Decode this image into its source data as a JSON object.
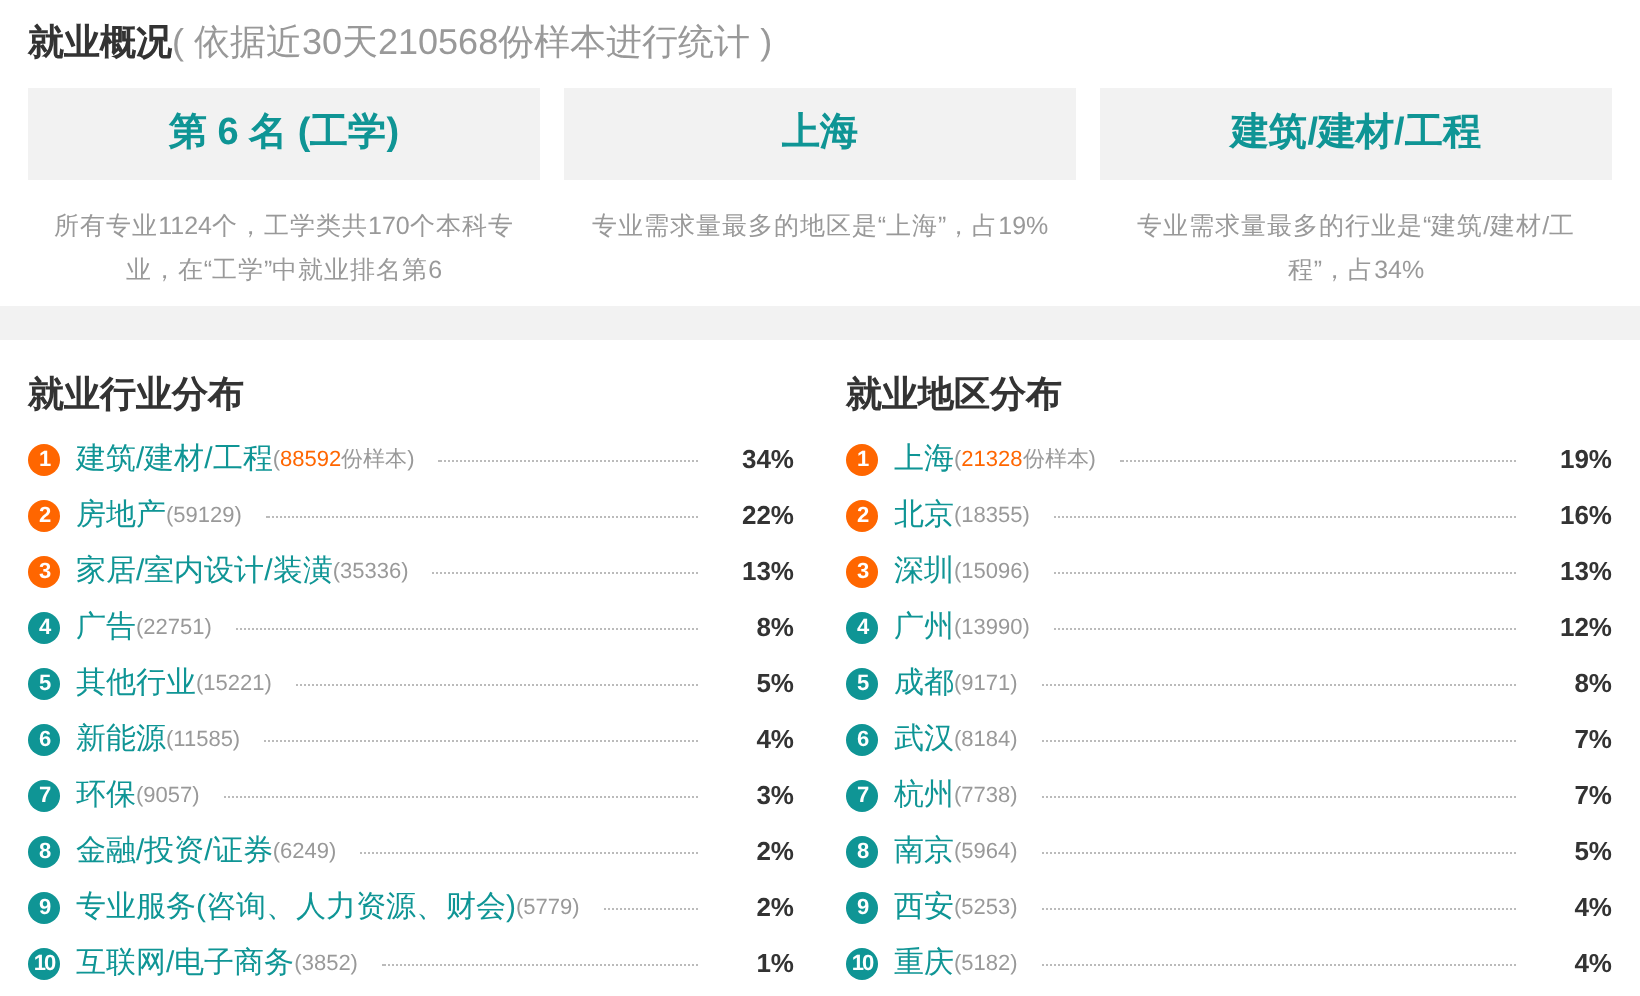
{
  "header": {
    "title": "就业概况",
    "subtitle": "( 依据近30天210568份样本进行统计 )"
  },
  "summary": [
    {
      "value": "第 6 名 (工学)",
      "description": "所有专业1124个，工学类共170个本科专业，在“工学”中就业排名第6"
    },
    {
      "value": "上海",
      "description": "专业需求量最多的地区是“上海”，占19%"
    },
    {
      "value": "建筑/建材/工程",
      "description": "专业需求量最多的行业是“建筑/建材/工程”，占34%"
    }
  ],
  "industry": {
    "title": "就业行业分布",
    "items": [
      {
        "rank": "1",
        "color": "#ff6600",
        "name": "建筑/建材/工程",
        "count_before": "(",
        "count_highlight": "88592",
        "count_after": "份样本)",
        "percent": "34%"
      },
      {
        "rank": "2",
        "color": "#ff6600",
        "name": "房地产",
        "count": "(59129)",
        "percent": "22%"
      },
      {
        "rank": "3",
        "color": "#ff6600",
        "name": "家居/室内设计/装潢",
        "count": "(35336)",
        "percent": "13%"
      },
      {
        "rank": "4",
        "color": "#0f9595",
        "name": "广告",
        "count": "(22751)",
        "percent": "8%"
      },
      {
        "rank": "5",
        "color": "#0f9595",
        "name": "其他行业",
        "count": "(15221)",
        "percent": "5%"
      },
      {
        "rank": "6",
        "color": "#0f9595",
        "name": "新能源",
        "count": "(11585)",
        "percent": "4%"
      },
      {
        "rank": "7",
        "color": "#0f9595",
        "name": "环保",
        "count": "(9057)",
        "percent": "3%"
      },
      {
        "rank": "8",
        "color": "#0f9595",
        "name": "金融/投资/证券",
        "count": "(6249)",
        "percent": "2%"
      },
      {
        "rank": "9",
        "color": "#0f9595",
        "name": "专业服务(咨询、人力资源、财会)",
        "count": "(5779)",
        "percent": "2%"
      },
      {
        "rank": "10",
        "color": "#0f9595",
        "name": "互联网/电子商务",
        "count": "(3852)",
        "percent": "1%"
      }
    ]
  },
  "region": {
    "title": "就业地区分布",
    "items": [
      {
        "rank": "1",
        "color": "#ff6600",
        "name": "上海",
        "count_before": "(",
        "count_highlight": "21328",
        "count_after": "份样本)",
        "percent": "19%"
      },
      {
        "rank": "2",
        "color": "#ff6600",
        "name": "北京",
        "count": "(18355)",
        "percent": "16%"
      },
      {
        "rank": "3",
        "color": "#ff6600",
        "name": "深圳",
        "count": "(15096)",
        "percent": "13%"
      },
      {
        "rank": "4",
        "color": "#0f9595",
        "name": "广州",
        "count": "(13990)",
        "percent": "12%"
      },
      {
        "rank": "5",
        "color": "#0f9595",
        "name": "成都",
        "count": "(9171)",
        "percent": "8%"
      },
      {
        "rank": "6",
        "color": "#0f9595",
        "name": "武汉",
        "count": "(8184)",
        "percent": "7%"
      },
      {
        "rank": "7",
        "color": "#0f9595",
        "name": "杭州",
        "count": "(7738)",
        "percent": "7%"
      },
      {
        "rank": "8",
        "color": "#0f9595",
        "name": "南京",
        "count": "(5964)",
        "percent": "5%"
      },
      {
        "rank": "9",
        "color": "#0f9595",
        "name": "西安",
        "count": "(5253)",
        "percent": "4%"
      },
      {
        "rank": "10",
        "color": "#0f9595",
        "name": "重庆",
        "count": "(5182)",
        "percent": "4%"
      }
    ]
  }
}
